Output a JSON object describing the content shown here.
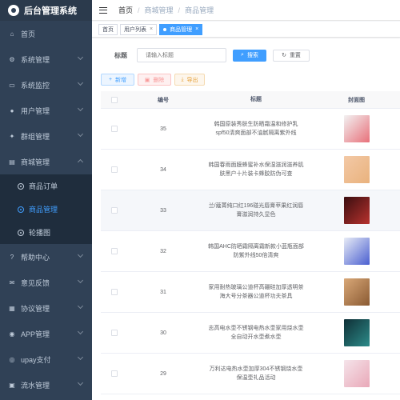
{
  "app": {
    "title": "后台管理系统"
  },
  "sidebar": {
    "items": [
      {
        "label": "首页",
        "icon": "home-icon",
        "glyph": "⌂",
        "arrow": false
      },
      {
        "label": "系统管理",
        "icon": "gear-icon",
        "glyph": "⚙",
        "arrow": true
      },
      {
        "label": "系统监控",
        "icon": "monitor-icon",
        "glyph": "▭",
        "arrow": true
      },
      {
        "label": "用户管理",
        "icon": "user-icon",
        "glyph": "●",
        "arrow": true
      },
      {
        "label": "群组管理",
        "icon": "group-icon",
        "glyph": "✦",
        "arrow": true
      },
      {
        "label": "商城管理",
        "icon": "shop-icon",
        "glyph": "▤",
        "arrow": true,
        "open": true
      }
    ],
    "submenu": [
      {
        "label": "商品订单",
        "active": false
      },
      {
        "label": "商品管理",
        "active": true
      },
      {
        "label": "轮播图",
        "active": false
      }
    ],
    "items_after": [
      {
        "label": "帮助中心",
        "icon": "help-icon",
        "glyph": "?",
        "arrow": true
      },
      {
        "label": "意见反馈",
        "icon": "feedback-icon",
        "glyph": "✉",
        "arrow": true
      },
      {
        "label": "协议管理",
        "icon": "document-icon",
        "glyph": "▦",
        "arrow": true
      },
      {
        "label": "APP管理",
        "icon": "app-icon",
        "glyph": "◉",
        "arrow": true
      },
      {
        "label": "upay支付",
        "icon": "pay-icon",
        "glyph": "◎",
        "arrow": true
      },
      {
        "label": "流水管理",
        "icon": "ledger-icon",
        "glyph": "▣",
        "arrow": true
      }
    ]
  },
  "header": {
    "breadcrumb": [
      "首页",
      "商城管理",
      "商品管理"
    ]
  },
  "tags": [
    {
      "label": "首页",
      "closable": false,
      "active": false
    },
    {
      "label": "用户列表",
      "closable": true,
      "active": false
    },
    {
      "label": "商品管理",
      "closable": true,
      "active": true
    }
  ],
  "search": {
    "label": "标题",
    "placeholder": "请输入标题",
    "search_btn": "搜索",
    "reset_btn": "重置"
  },
  "actions": {
    "add": "新增",
    "delete": "删除",
    "export": "导出"
  },
  "table": {
    "columns": [
      "编号",
      "标题",
      "封面图"
    ],
    "rows": [
      {
        "id": "35",
        "title": "韩国原装秀肤生防晒霜温和修护乳spf50清爽面部不油腻隔离紫外线",
        "thumb": [
          "#f2f2f2",
          "#e8707a"
        ]
      },
      {
        "id": "34",
        "title": "韩国春雨面膜蜂蜜补水保湿滋润滋养肌肤黑户十片装卡蜂胶防伪可查",
        "thumb": [
          "#f3c9a6",
          "#e9b27d"
        ]
      },
      {
        "id": "33",
        "title": "兰/蔻菁纯口红196碰光唇膏苹果红润唇膏滋润持久显色",
        "thumb": [
          "#3a0e10",
          "#b8322e"
        ]
      },
      {
        "id": "32",
        "title": "韩国AHC防晒霜隔离霜新款小蓝瓶面部防紫外线50倍清爽",
        "thumb": [
          "#e8ecf6",
          "#4a5fd0"
        ]
      },
      {
        "id": "31",
        "title": "家用耐热玻璃公道杯高硼硅加厚透明茶海大号分茶器公道杯功夫茶具",
        "thumb": [
          "#d9a878",
          "#8a5a32"
        ]
      },
      {
        "id": "30",
        "title": "志高电水壶不锈钢电热水壶家用烧水壶全自动开水壶煮水壶",
        "thumb": [
          "#0f2f36",
          "#2d8c8a"
        ]
      },
      {
        "id": "29",
        "title": "万利达电热水壶加厚304不锈钢烧水壶保温壶礼品活动",
        "thumb": [
          "#f5e4ea",
          "#e9a8b8"
        ]
      }
    ]
  }
}
